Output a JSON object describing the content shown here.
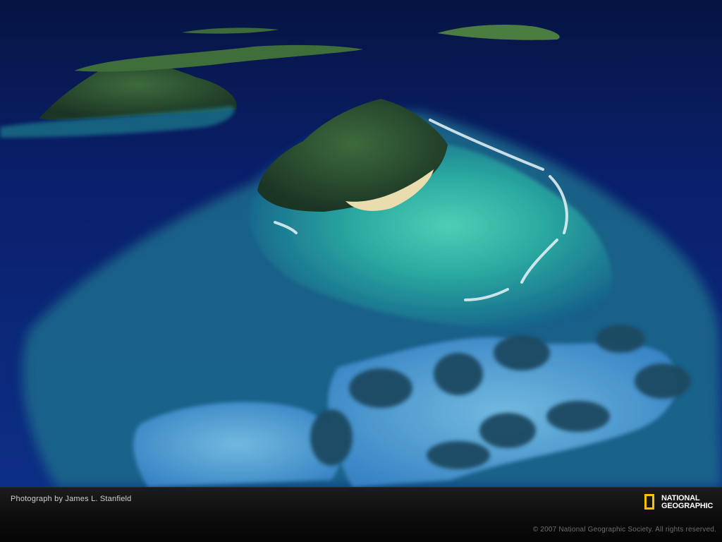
{
  "photo": {
    "colors": {
      "deep_ocean": "#0b1f6e",
      "navy": "#061442",
      "lagoon": "#2fb3a6",
      "reef_light": "#5fcfc0",
      "shallow_blue": "#4f9bd6",
      "island_green": "#2d5a34",
      "sand": "#e9dcae",
      "surf": "#e8f4f8"
    }
  },
  "footer": {
    "credit": "Photograph by James L. Stanfield",
    "logo_line1": "NATIONAL",
    "logo_line2": "GEOGRAPHIC",
    "copyright": "© 2007 National Geographic Society. All rights reserved.",
    "logo_color": "#f5c400"
  }
}
